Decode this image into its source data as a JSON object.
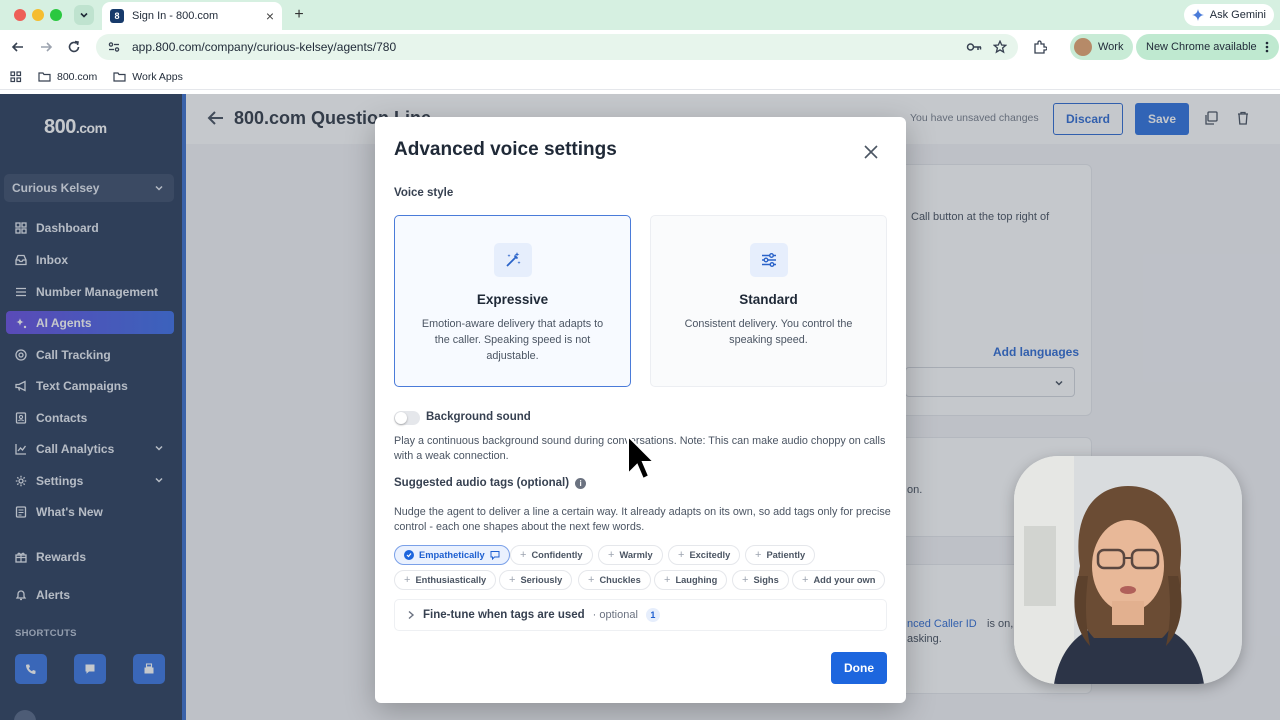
{
  "browser": {
    "tab_title": "Sign In - 800.com",
    "tab_favicon_text": "8",
    "url": "app.800.com/company/curious-kelsey/agents/780",
    "ask_gemini": "Ask Gemini",
    "profile_label": "Work",
    "update_label": "New Chrome available",
    "bookmarks": [
      "800.com",
      "Work Apps"
    ]
  },
  "sidebar": {
    "logo": "800",
    "logo_suffix": ".com",
    "account": "Curious Kelsey",
    "items": [
      {
        "label": "Dashboard",
        "icon": "grid-icon"
      },
      {
        "label": "Inbox",
        "icon": "inbox-icon"
      },
      {
        "label": "Number Management",
        "icon": "list-icon"
      },
      {
        "label": "AI Agents",
        "icon": "sparkle-icon",
        "active": true
      },
      {
        "label": "Call Tracking",
        "icon": "target-icon"
      },
      {
        "label": "Text Campaigns",
        "icon": "megaphone-icon"
      },
      {
        "label": "Contacts",
        "icon": "contacts-icon"
      },
      {
        "label": "Call Analytics",
        "icon": "chart-icon",
        "expandable": true
      },
      {
        "label": "Settings",
        "icon": "gear-icon",
        "expandable": true
      },
      {
        "label": "What's New",
        "icon": "news-icon"
      },
      {
        "label": "Rewards",
        "icon": "gift-icon"
      },
      {
        "label": "Alerts",
        "icon": "bell-icon"
      }
    ],
    "shortcuts_heading": "SHORTCUTS"
  },
  "page": {
    "title": "800.com Question Line",
    "unsaved_notice": "You have unsaved changes",
    "discard_label": "Discard",
    "save_label": "Save",
    "bg_text_1": "Call button at the top right of",
    "add_languages": "Add languages",
    "bg_text_2": "on.",
    "bg_text_3": "nced Caller ID",
    "bg_text_4": "is on,",
    "bg_text_5": "asking."
  },
  "modal": {
    "title": "Advanced voice settings",
    "voice_style_label": "Voice style",
    "styles": [
      {
        "title": "Expressive",
        "description": "Emotion-aware delivery that adapts to the caller. Speaking speed is not adjustable.",
        "selected": true
      },
      {
        "title": "Standard",
        "description": "Consistent delivery. You control the speaking speed.",
        "selected": false
      }
    ],
    "background_sound_label": "Background sound",
    "background_sound_on": false,
    "background_sound_desc": "Play a continuous background sound during conversations. Note: This can make audio choppy on calls with a weak connection.",
    "tags_label": "Suggested audio tags (optional)",
    "tags_desc": "Nudge the agent to deliver a line a certain way. It already adapts on its own, so add tags only for precise control - each one shapes about the next few words.",
    "tags_row1": [
      {
        "label": "Empathetically",
        "selected": true
      },
      {
        "label": "Confidently",
        "selected": false
      },
      {
        "label": "Warmly",
        "selected": false
      },
      {
        "label": "Excitedly",
        "selected": false
      },
      {
        "label": "Patiently",
        "selected": false
      }
    ],
    "tags_row2": [
      {
        "label": "Enthusiastically",
        "selected": false
      },
      {
        "label": "Seriously",
        "selected": false
      },
      {
        "label": "Chuckles",
        "selected": false
      },
      {
        "label": "Laughing",
        "selected": false
      },
      {
        "label": "Sighs",
        "selected": false
      },
      {
        "label": "Add your own",
        "selected": false
      }
    ],
    "finetune_label": "Fine-tune when tags are used",
    "finetune_optional": "· optional",
    "finetune_count": "1",
    "done_label": "Done"
  }
}
